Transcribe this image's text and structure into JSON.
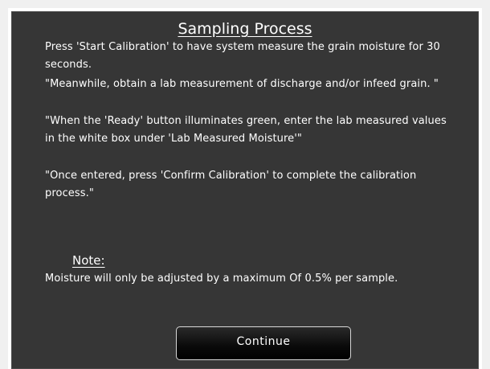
{
  "dialog": {
    "title": "Sampling Process",
    "paragraphs": [
      "Press 'Start Calibration' to have system measure the grain moisture for 30 seconds.",
      "\"Meanwhile, obtain a lab measurement of discharge and/or infeed grain. \"",
      "\"When the 'Ready' button illuminates green, enter the lab measured values in the white box under 'Lab Measured Moisture'\"",
      "\"Once entered, press 'Confirm Calibration' to complete the calibration process.\""
    ],
    "note_label": "Note:",
    "note_text": "Moisture will only be adjusted by a maximum Of 0.5% per sample.",
    "continue_label": "Continue"
  },
  "colors": {
    "panel_background": "#363636",
    "text": "#ffffff",
    "button_background": "#000000"
  }
}
